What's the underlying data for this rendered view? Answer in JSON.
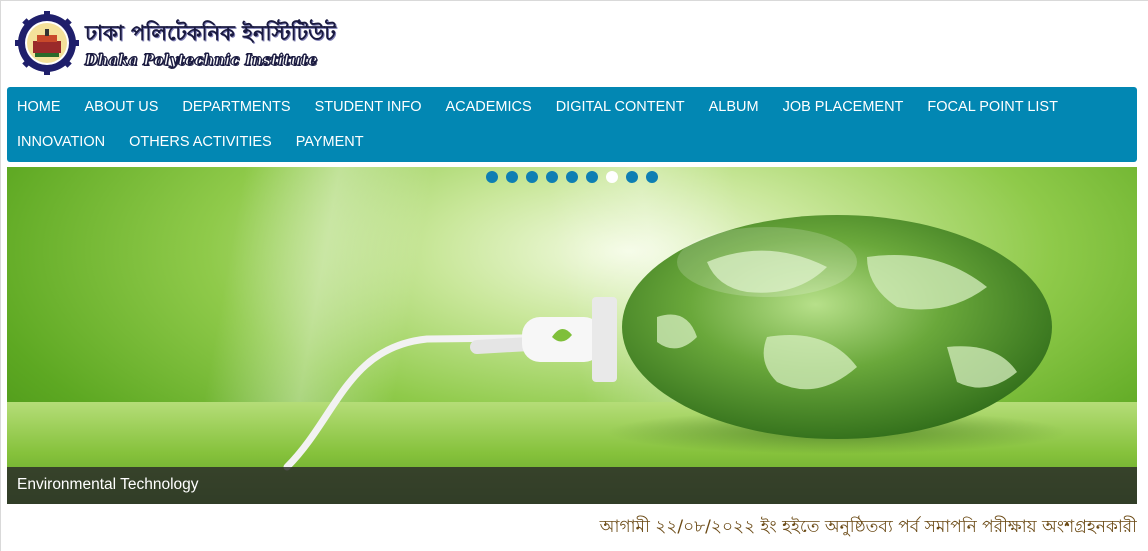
{
  "brand": {
    "name_bn": "ঢাকা পলিটেকনিক ইনস্টিটিউট",
    "name_en": "Dhaka Polytechnic Institute",
    "logo_icon": "institute-gear-emblem-icon"
  },
  "nav": {
    "items": [
      {
        "label": "HOME"
      },
      {
        "label": "ABOUT US"
      },
      {
        "label": "DEPARTMENTS"
      },
      {
        "label": "STUDENT INFO"
      },
      {
        "label": "ACADEMICS"
      },
      {
        "label": "DIGITAL CONTENT"
      },
      {
        "label": "ALBUM"
      },
      {
        "label": "JOB PLACEMENT"
      },
      {
        "label": "FOCAL POINT LIST"
      },
      {
        "label": "INNOVATION"
      },
      {
        "label": "OTHERS ACTIVITIES"
      },
      {
        "label": "PAYMENT"
      }
    ]
  },
  "slider": {
    "caption": "Environmental Technology",
    "dot_count": 9,
    "active_dot": 7,
    "image_icon": "earth-with-plug-cable-image"
  },
  "notice": {
    "text": "আগামী ২২/০৮/২০২২ ইং হইতে অনুষ্ঠিতব্য পর্ব সমাপনি পরীক্ষায় অংশগ্রহনকারী"
  },
  "colors": {
    "nav_bg": "#0287b3",
    "nav_text": "#ffffff",
    "dot": "#0e7fb3",
    "dot_active": "#ffffff",
    "caption_bg": "#282828",
    "notice_text": "#6b4a15"
  }
}
